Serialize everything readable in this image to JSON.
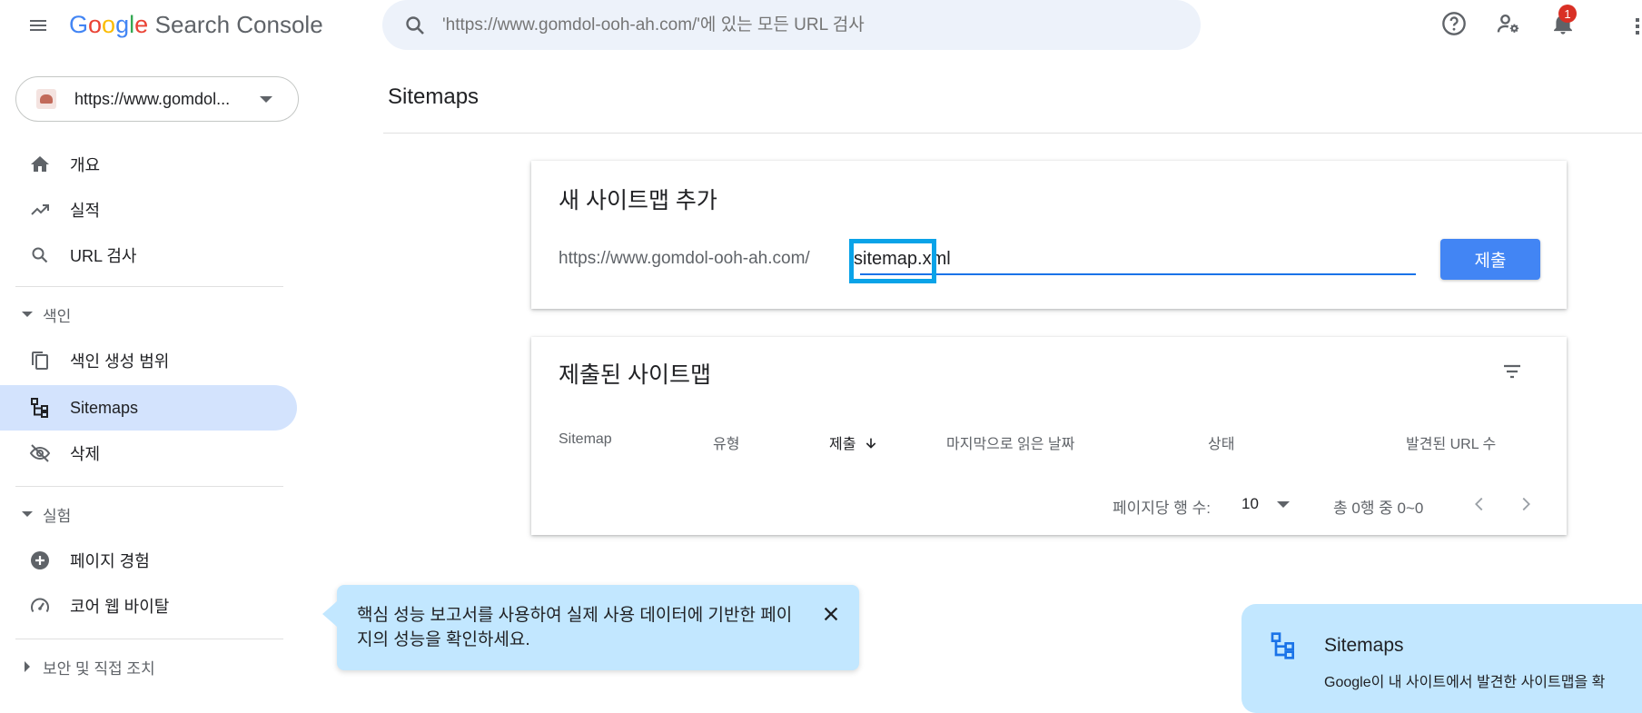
{
  "app": {
    "logo_google": [
      "G",
      "o",
      "o",
      "g",
      "l",
      "e"
    ],
    "logo_rest": "Search Console"
  },
  "search": {
    "placeholder": "'https://www.gomdol-ooh-ah.com/'에 있는 모든 URL 검사"
  },
  "notifications": {
    "count": "1"
  },
  "property": {
    "label": "https://www.gomdol..."
  },
  "sidebar": {
    "items": [
      {
        "label": "개요",
        "icon": "home-icon"
      },
      {
        "label": "실적",
        "icon": "trending-up-icon"
      },
      {
        "label": "URL 검사",
        "icon": "search-icon"
      }
    ],
    "sections": [
      {
        "label": "색인",
        "items": [
          {
            "label": "색인 생성 범위",
            "icon": "copy-pages-icon"
          },
          {
            "label": "Sitemaps",
            "icon": "sitemap-icon",
            "active": true
          },
          {
            "label": "삭제",
            "icon": "visibility-off-icon"
          }
        ]
      },
      {
        "label": "실험",
        "items": [
          {
            "label": "페이지 경험",
            "icon": "add-circle-icon"
          },
          {
            "label": "코어 웹 바이탈",
            "icon": "speed-gauge-icon"
          }
        ]
      },
      {
        "label": "보안 및 직접 조치",
        "collapsed": true
      }
    ]
  },
  "page": {
    "title": "Sitemaps"
  },
  "add_sitemap": {
    "title": "새 사이트맵 추가",
    "prefix": "https://www.gomdol-ooh-ah.com/",
    "value": "sitemap.xml",
    "submit_label": "제출"
  },
  "submitted": {
    "title": "제출된 사이트맵",
    "columns": [
      "Sitemap",
      "유형",
      "제출",
      "마지막으로 읽은 날짜",
      "상태",
      "발견된 URL 수"
    ],
    "sorted_column": "제출",
    "rows_per_page_label": "페이지당 행 수:",
    "rows_per_page": "10",
    "range_text": "총 0행 중 0~0"
  },
  "toast": {
    "text": "핵심 성능 보고서를 사용하여 실제 사용 데이터에 기반한 페이지의 성능을 확인하세요."
  },
  "help": {
    "title": "Sitemaps",
    "subtitle": "Google이 내 사이트에서 발견한 사이트맵을 확"
  },
  "colors": {
    "accent": "#1a73e8",
    "active_nav": "#d3e3fd",
    "toast_bg": "#c2e7ff",
    "highlight_box": "#0aa3e8"
  }
}
